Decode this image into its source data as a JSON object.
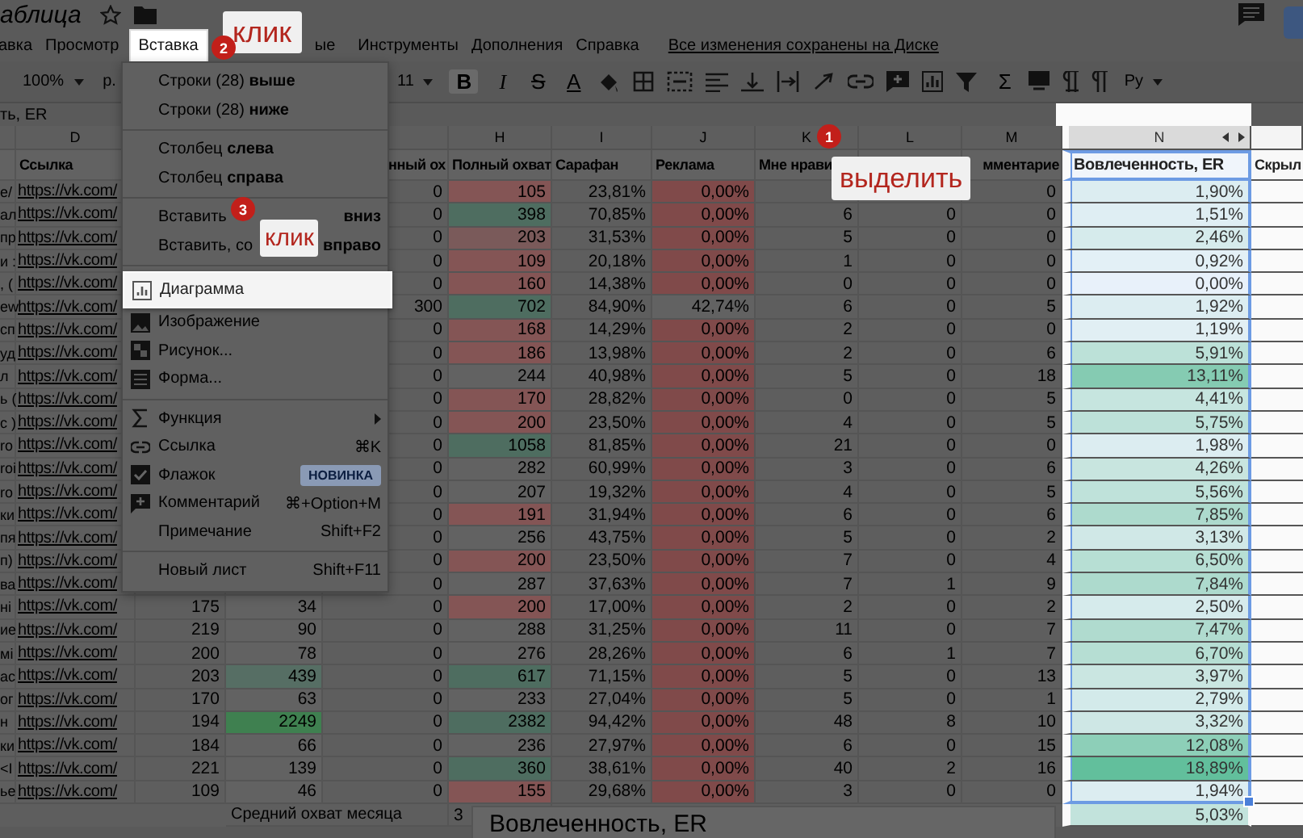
{
  "doc": {
    "title": "аблица"
  },
  "menubar": [
    {
      "label": "авка",
      "selected": false
    },
    {
      "label": "Просмотр",
      "selected": false
    },
    {
      "label": "Вставка",
      "selected": true
    },
    {
      "label": "ые",
      "selected": false
    },
    {
      "label": "Инструменты",
      "selected": false
    },
    {
      "label": "Дополнения",
      "selected": false
    },
    {
      "label": "Справка",
      "selected": false
    }
  ],
  "save_status": "Все изменения сохранены на Диске",
  "toolbar": {
    "zoom": "100%",
    "currency": "р.",
    "font_size": "11",
    "format": [
      "B",
      "I",
      "S",
      "A"
    ],
    "sum": "Σ",
    "input_tool": "Ру"
  },
  "formula_bar": {
    "text": "ть, ER"
  },
  "sheet": {
    "letters": {
      "d": "D",
      "h": "H",
      "i": "I",
      "j": "J",
      "k": "K",
      "l": "L",
      "m": "M",
      "n": "N"
    },
    "headers": {
      "d": "Ссылка",
      "g": "нный ох",
      "h": "Полный охват",
      "i": "Сарафан",
      "j": "Реклама",
      "k": "Мне нрави",
      "m": "мментарие",
      "n": "Вовлеченность, ER",
      "o": "Скрыл"
    },
    "rows": [
      {
        "frag": "е/",
        "d": "https://vk.com/",
        "g": "0",
        "h": {
          "text": "105",
          "color": "#845555"
        },
        "i": "23,81%",
        "j": {
          "text": "0,00%",
          "color": "#804a4a"
        },
        "m": "0",
        "n": {
          "text": "1,90%",
          "color": "#dcedf1"
        }
      },
      {
        "frag": "ал",
        "d": "https://vk.com/",
        "g": "0",
        "h": {
          "text": "398",
          "color": "#4e6d60"
        },
        "i": "70,85%",
        "j": {
          "text": "0,00%",
          "color": "#804a4a"
        },
        "k": "6",
        "l": "0",
        "m": "0",
        "n": {
          "text": "1,51%",
          "color": "#dfeef3"
        }
      },
      {
        "frag": "пр",
        "d": "https://vk.com/",
        "g": "0",
        "h": {
          "text": "203",
          "color": "#7a5a5a"
        },
        "i": "31,53%",
        "j": {
          "text": "0,00%",
          "color": "#804a4a"
        },
        "k": "5",
        "l": "0",
        "m": "0",
        "n": {
          "text": "2,46%",
          "color": "#d6ebec"
        }
      },
      {
        "frag": "и :",
        "d": "https://vk.com/",
        "g": "0",
        "h": {
          "text": "109",
          "color": "#845555"
        },
        "i": "20,18%",
        "j": {
          "text": "0,00%",
          "color": "#804a4a"
        },
        "k": "1",
        "l": "0",
        "m": "0",
        "n": {
          "text": "0,92%",
          "color": "#e3f0f6"
        }
      },
      {
        "frag": ", (",
        "d": "https://vk.com/",
        "g": "0",
        "h": {
          "text": "160",
          "color": "#845555"
        },
        "i": "14,38%",
        "j": {
          "text": "0,00%",
          "color": "#804a4a"
        },
        "k": "0",
        "l": "0",
        "m": "0",
        "n": {
          "text": "0,00%",
          "color": "#e8f1fa"
        }
      },
      {
        "frag": "ew",
        "d": "https://vk.com/",
        "g": "300",
        "h": {
          "text": "702",
          "color": "#4e6d60"
        },
        "i": "84,90%",
        "j": {
          "text": "42,74%",
          "color": "#626262"
        },
        "k": "6",
        "l": "0",
        "m": "5",
        "n": {
          "text": "1,92%",
          "color": "#dcedf1"
        }
      },
      {
        "frag": "сп",
        "d": "https://vk.com/",
        "g": "0",
        "h": {
          "text": "168",
          "color": "#845555"
        },
        "i": "14,29%",
        "j": {
          "text": "0,00%",
          "color": "#804a4a"
        },
        "k": "2",
        "l": "0",
        "m": "0",
        "n": {
          "text": "1,19%",
          "color": "#e1eff4"
        }
      },
      {
        "frag": "уд",
        "d": "https://vk.com/",
        "g": "0",
        "h": {
          "text": "186",
          "color": "#845555"
        },
        "i": "13,98%",
        "j": {
          "text": "0,00%",
          "color": "#804a4a"
        },
        "k": "2",
        "l": "0",
        "m": "6",
        "n": {
          "text": "5,91%",
          "color": "#bce1d8"
        }
      },
      {
        "frag": "л",
        "d": "https://vk.com/",
        "g": "0",
        "h": {
          "text": "244",
          "color": "#626262"
        },
        "i": "40,98%",
        "j": {
          "text": "0,00%",
          "color": "#804a4a"
        },
        "k": "5",
        "l": "0",
        "m": "18",
        "n": {
          "text": "13,11%",
          "color": "#85cbb2"
        }
      },
      {
        "frag": "ь (",
        "d": "https://vk.com/",
        "g": "0",
        "h": {
          "text": "170",
          "color": "#845555"
        },
        "i": "28,82%",
        "j": {
          "text": "0,00%",
          "color": "#804a4a"
        },
        "k": "0",
        "l": "0",
        "m": "5",
        "n": {
          "text": "4,41%",
          "color": "#c6e5df"
        }
      },
      {
        "frag": "с )",
        "d": "https://vk.com/",
        "g": "0",
        "h": {
          "text": "200",
          "color": "#845555"
        },
        "i": "23,50%",
        "j": {
          "text": "0,00%",
          "color": "#804a4a"
        },
        "k": "4",
        "l": "0",
        "m": "5",
        "n": {
          "text": "5,75%",
          "color": "#bde1d9"
        }
      },
      {
        "frag": "ro",
        "d": "https://vk.com/",
        "g": "0",
        "h": {
          "text": "1058",
          "color": "#4e6d60"
        },
        "i": "81,85%",
        "j": {
          "text": "0,00%",
          "color": "#804a4a"
        },
        "k": "21",
        "l": "0",
        "m": "0",
        "n": {
          "text": "1,98%",
          "color": "#dcedf1"
        }
      },
      {
        "frag": "roi",
        "d": "https://vk.com/",
        "g": "0",
        "h": {
          "text": "282",
          "color": "#626262"
        },
        "i": "60,99%",
        "j": {
          "text": "0,00%",
          "color": "#804a4a"
        },
        "k": "3",
        "l": "0",
        "m": "6",
        "n": {
          "text": "4,26%",
          "color": "#c8e5df"
        }
      },
      {
        "frag": "ro",
        "d": "https://vk.com/",
        "g": "0",
        "h": {
          "text": "207",
          "color": "#626262"
        },
        "i": "19,32%",
        "j": {
          "text": "0,00%",
          "color": "#804a4a"
        },
        "k": "4",
        "l": "0",
        "m": "5",
        "n": {
          "text": "5,56%",
          "color": "#bfe2da"
        }
      },
      {
        "frag": "ки",
        "d": "https://vk.com/",
        "g": "0",
        "h": {
          "text": "191",
          "color": "#845555"
        },
        "i": "31,94%",
        "j": {
          "text": "0,00%",
          "color": "#804a4a"
        },
        "k": "6",
        "l": "0",
        "m": "6",
        "n": {
          "text": "7,85%",
          "color": "#addacd"
        }
      },
      {
        "frag": "пя",
        "d": "https://vk.com/",
        "g": "0",
        "h": {
          "text": "256",
          "color": "#626262"
        },
        "i": "43,75%",
        "j": {
          "text": "0,00%",
          "color": "#804a4a"
        },
        "k": "5",
        "l": "0",
        "m": "2",
        "n": {
          "text": "3,13%",
          "color": "#d0e8e7"
        }
      },
      {
        "frag": "п)",
        "d": "https://vk.com/",
        "g": "0",
        "h": {
          "text": "200",
          "color": "#845555"
        },
        "i": "23,50%",
        "j": {
          "text": "0,00%",
          "color": "#804a4a"
        },
        "k": "7",
        "l": "0",
        "m": "4",
        "n": {
          "text": "6,50%",
          "color": "#b7dfd4"
        }
      },
      {
        "frag": "ва",
        "d": "https://vk.com/",
        "g": "0",
        "h": {
          "text": "287",
          "color": "#626262"
        },
        "i": "37,63%",
        "j": {
          "text": "0,00%",
          "color": "#804a4a"
        },
        "k": "7",
        "l": "1",
        "m": "9",
        "n": {
          "text": "7,84%",
          "color": "#addacd"
        }
      },
      {
        "frag": "ні",
        "d": "https://vk.com/",
        "e": "175",
        "f": {
          "text": "34",
          "color": "#626262"
        },
        "g": "0",
        "h": {
          "text": "200",
          "color": "#845555"
        },
        "i": "17,00%",
        "j": {
          "text": "0,00%",
          "color": "#804a4a"
        },
        "k": "2",
        "l": "0",
        "m": "2",
        "n": {
          "text": "2,50%",
          "color": "#d6ebec"
        }
      },
      {
        "frag": "ие",
        "d": "https://vk.com/",
        "e": "219",
        "f": {
          "text": "90",
          "color": "#626262"
        },
        "g": "0",
        "h": {
          "text": "288",
          "color": "#626262"
        },
        "i": "31,25%",
        "j": {
          "text": "0,00%",
          "color": "#804a4a"
        },
        "k": "11",
        "l": "0",
        "m": "7",
        "n": {
          "text": "7,47%",
          "color": "#b0dbcf"
        }
      },
      {
        "frag": "мі",
        "d": "https://vk.com/",
        "e": "200",
        "f": {
          "text": "78",
          "color": "#626262"
        },
        "g": "0",
        "h": {
          "text": "276",
          "color": "#626262"
        },
        "i": "28,26%",
        "j": {
          "text": "0,00%",
          "color": "#804a4a"
        },
        "k": "6",
        "l": "1",
        "m": "7",
        "n": {
          "text": "6,70%",
          "color": "#b6ded3"
        }
      },
      {
        "frag": "ас",
        "d": "https://vk.com/",
        "e": "203",
        "f": {
          "text": "439",
          "color": "#566e64"
        },
        "g": "0",
        "h": {
          "text": "617",
          "color": "#4e6d60"
        },
        "i": "71,15%",
        "j": {
          "text": "0,00%",
          "color": "#804a4a"
        },
        "k": "5",
        "l": "0",
        "m": "13",
        "n": {
          "text": "3,97%",
          "color": "#cae6e1"
        }
      },
      {
        "frag": "ог",
        "d": "https://vk.com/",
        "e": "170",
        "f": {
          "text": "63",
          "color": "#626262"
        },
        "g": "0",
        "h": {
          "text": "233",
          "color": "#626262"
        },
        "i": "27,04%",
        "j": {
          "text": "0,00%",
          "color": "#804a4a"
        },
        "k": "5",
        "l": "0",
        "m": "1",
        "n": {
          "text": "2,79%",
          "color": "#d3eaea"
        }
      },
      {
        "frag": "н",
        "d": "https://vk.com/",
        "e": "194",
        "f": {
          "text": "2249",
          "color": "#3f8050"
        },
        "g": "0",
        "h": {
          "text": "2382",
          "color": "#4e6d60"
        },
        "i": "94,42%",
        "j": {
          "text": "0,00%",
          "color": "#804a4a"
        },
        "k": "48",
        "l": "8",
        "m": "10",
        "n": {
          "text": "3,32%",
          "color": "#cee7e5"
        }
      },
      {
        "frag": "ки",
        "d": "https://vk.com/",
        "e": "184",
        "f": {
          "text": "66",
          "color": "#626262"
        },
        "g": "0",
        "h": {
          "text": "236",
          "color": "#626262"
        },
        "i": "27,97%",
        "j": {
          "text": "0,00%",
          "color": "#804a4a"
        },
        "k": "6",
        "l": "0",
        "m": "15",
        "n": {
          "text": "12,08%",
          "color": "#8dcfb8"
        }
      },
      {
        "frag": "<I",
        "d": "https://vk.com/",
        "e": "221",
        "f": {
          "text": "139",
          "color": "#626262"
        },
        "g": "0",
        "h": {
          "text": "360",
          "color": "#4e6d60"
        },
        "i": "38,61%",
        "j": {
          "text": "0,00%",
          "color": "#804a4a"
        },
        "k": "40",
        "l": "2",
        "m": "16",
        "n": {
          "text": "18,89%",
          "color": "#62bf9c"
        }
      },
      {
        "frag": "ье",
        "d": "https://vk.com/",
        "e": "109",
        "f": {
          "text": "46",
          "color": "#626262"
        },
        "g": "0",
        "h": {
          "text": "155",
          "color": "#845555"
        },
        "i": "29,68%",
        "j": {
          "text": "0,00%",
          "color": "#804a4a"
        },
        "k": "3",
        "l": "0",
        "m": "0",
        "n": {
          "text": "1,94%",
          "color": "#dcedf1"
        }
      }
    ],
    "footer_rows": [
      {
        "f": "Средний охват месяца",
        "h": "3",
        "n": {
          "text": "5,03%",
          "color": "#c2e3dc"
        }
      }
    ]
  },
  "chart_preview": {
    "title": "Вовлеченность, ER"
  },
  "insert_menu": {
    "items": [
      {
        "kind": "item",
        "label": "Строки (28) **выше**",
        "selected": false
      },
      {
        "kind": "item",
        "label": "Строки (28) **ниже**",
        "selected": false
      },
      {
        "kind": "divider"
      },
      {
        "kind": "item",
        "label": "Столбец **слева**",
        "selected": false
      },
      {
        "kind": "item",
        "label": "Столбец **справа**",
        "selected": false
      },
      {
        "kind": "divider"
      },
      {
        "kind": "split",
        "label_left": "Вставить",
        "label_right": "вниз",
        "selected": false
      },
      {
        "kind": "split",
        "label_left": "Вставить, со",
        "label_right": "вправо",
        "selected": false
      },
      {
        "kind": "divider"
      },
      {
        "kind": "item",
        "label": "Диаграмма",
        "selected": true
      },
      {
        "kind": "item",
        "label": "Изображение",
        "selected": false
      },
      {
        "kind": "item",
        "label": "Рисунок...",
        "selected": false
      },
      {
        "kind": "item",
        "label": "Форма...",
        "selected": false
      },
      {
        "kind": "divider"
      },
      {
        "kind": "item",
        "label": "Функция",
        "submenu": true,
        "selected": false
      },
      {
        "kind": "item",
        "label": "Ссылка",
        "shortcut": "⌘K",
        "selected": false
      },
      {
        "kind": "item",
        "label": "Флажок",
        "badge": "НОВИНКА",
        "selected": false
      },
      {
        "kind": "item",
        "label": "Комментарий",
        "shortcut": "⌘+Option+M",
        "selected": false
      },
      {
        "kind": "item",
        "label": "Примечание",
        "shortcut": "Shift+F2",
        "selected": false
      },
      {
        "kind": "divider"
      },
      {
        "kind": "item",
        "label": "Новый лист",
        "shortcut": "Shift+F11",
        "selected": false
      }
    ]
  },
  "callouts": [
    {
      "number": "2",
      "text": "клик"
    },
    {
      "number": "1",
      "text": "выделить"
    },
    {
      "number": "3",
      "text": "клик"
    }
  ]
}
